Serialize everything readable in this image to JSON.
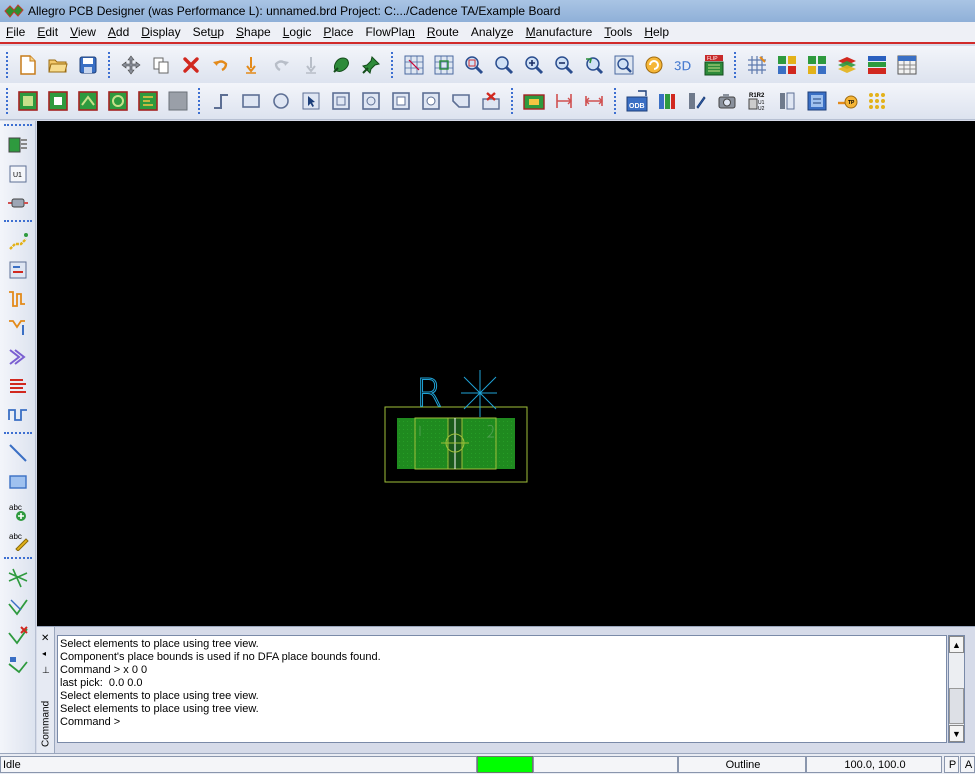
{
  "window": {
    "title": "Allegro PCB Designer (was Performance L): unnamed.brd  Project: C:.../Cadence TA/Example Board"
  },
  "menu": [
    {
      "label": "File",
      "u": "F",
      "rest": "ile"
    },
    {
      "label": "Edit",
      "u": "E",
      "rest": "dit"
    },
    {
      "label": "View",
      "u": "V",
      "rest": "iew"
    },
    {
      "label": "Add",
      "u": "A",
      "rest": "dd"
    },
    {
      "label": "Display",
      "u": "D",
      "rest": "isplay"
    },
    {
      "label": "Setup",
      "pre": "Set",
      "u": "u",
      "rest": "p"
    },
    {
      "label": "Shape",
      "u": "S",
      "rest": "hape"
    },
    {
      "label": "Logic",
      "u": "L",
      "rest": "ogic"
    },
    {
      "label": "Place",
      "u": "P",
      "rest": "lace"
    },
    {
      "label": "FlowPlan",
      "pre": "FlowPla",
      "u": "n",
      "rest": ""
    },
    {
      "label": "Route",
      "u": "R",
      "rest": "oute"
    },
    {
      "label": "Analyze",
      "pre": "Analy",
      "u": "z",
      "rest": "e"
    },
    {
      "label": "Manufacture",
      "u": "M",
      "rest": "anufacture"
    },
    {
      "label": "Tools",
      "u": "T",
      "rest": "ools"
    },
    {
      "label": "Help",
      "u": "H",
      "rest": "elp"
    }
  ],
  "canvas": {
    "refdes": "R",
    "pad_color": "#1f8a1f",
    "outline_color": "#9fbf3a",
    "silk_color": "#1fa3d8",
    "background": "#000000"
  },
  "command": {
    "tab_label": "Command",
    "lines": [
      "Select elements to place using tree view.",
      "Component's place bounds is used if no DFA place bounds found.",
      "Command > x 0 0",
      "last pick:  0.0 0.0",
      "Select elements to place using tree view.",
      "Select elements to place using tree view.",
      "Command >"
    ]
  },
  "status": {
    "state": "Idle",
    "indicator_color": "#00ff00",
    "layer": "Outline",
    "coords": "100.0, 100.0",
    "mode_p": "P",
    "mode_a": "A"
  }
}
